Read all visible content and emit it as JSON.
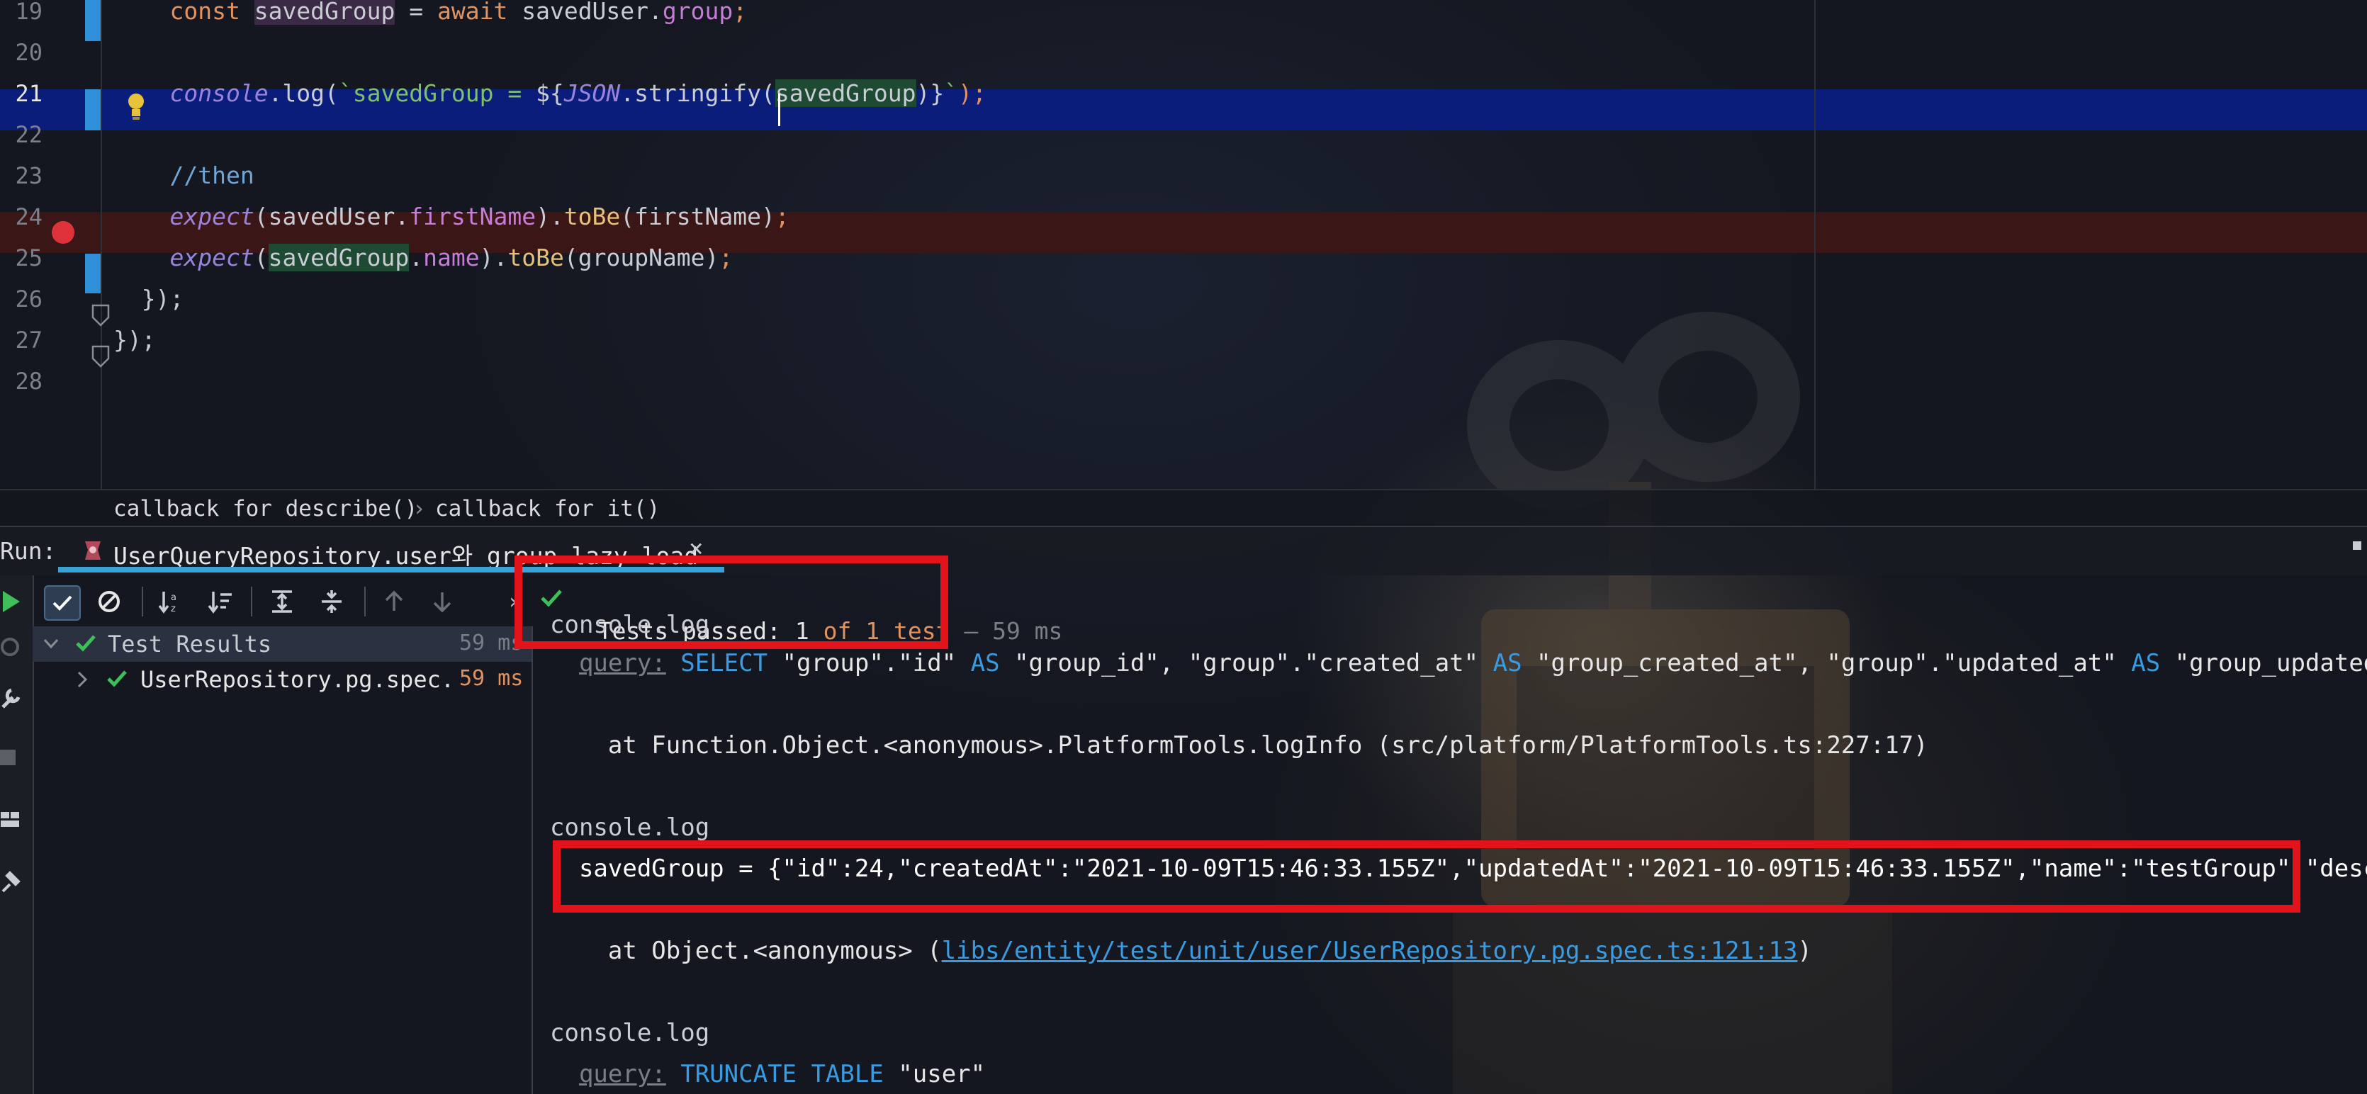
{
  "editor": {
    "lines": [
      {
        "no": "19",
        "segments": [
          {
            "t": "    ",
            "c": "#c9ccd3"
          },
          {
            "t": "const ",
            "c": "#e0935f"
          },
          {
            "t": "savedGroup",
            "c": "#c9ccd3",
            "bg": "#3b2a45"
          },
          {
            "t": " = ",
            "c": "#c9ccd3"
          },
          {
            "t": "await ",
            "c": "#e0935f"
          },
          {
            "t": "savedUser.",
            "c": "#c9ccd3"
          },
          {
            "t": "group",
            "c": "#c77dd8"
          },
          {
            "t": ";",
            "c": "#e0935f"
          }
        ]
      },
      {
        "no": "20",
        "segments": []
      },
      {
        "no": "21",
        "segments": [
          {
            "t": "    ",
            "c": "#c9ccd3"
          },
          {
            "t": "console",
            "c": "#9a84d9",
            "i": true
          },
          {
            "t": ".log(",
            "c": "#c9ccd3"
          },
          {
            "t": "`savedGroup = ",
            "c": "#7fbf6a"
          },
          {
            "t": "${",
            "c": "#c9ccd3"
          },
          {
            "t": "JSON",
            "c": "#9a84d9",
            "i": true
          },
          {
            "t": ".stringify(",
            "c": "#c9ccd3"
          },
          {
            "t": "savedGroup",
            "c": "#c9ccd3",
            "bg": "#1e4a34"
          },
          {
            "t": ")}",
            "c": "#c9ccd3"
          },
          {
            "t": "`",
            "c": "#7fbf6a"
          },
          {
            "t": ");",
            "c": "#e0935f"
          }
        ]
      },
      {
        "no": "22",
        "segments": []
      },
      {
        "no": "23",
        "segments": [
          {
            "t": "    ",
            "c": "#c9ccd3"
          },
          {
            "t": "//then",
            "c": "#6fa6d6"
          }
        ]
      },
      {
        "no": "24",
        "segments": [
          {
            "t": "    ",
            "c": "#c9ccd3"
          },
          {
            "t": "expect",
            "c": "#9a84d9",
            "i": true
          },
          {
            "t": "(savedUser.",
            "c": "#c9ccd3"
          },
          {
            "t": "firstName",
            "c": "#c77dd8"
          },
          {
            "t": ").",
            "c": "#c9ccd3"
          },
          {
            "t": "toBe",
            "c": "#e6c07b"
          },
          {
            "t": "(firstName)",
            "c": "#c9ccd3"
          },
          {
            "t": ";",
            "c": "#e0935f"
          }
        ]
      },
      {
        "no": "25",
        "segments": [
          {
            "t": "    ",
            "c": "#c9ccd3"
          },
          {
            "t": "expect",
            "c": "#9a84d9",
            "i": true
          },
          {
            "t": "(",
            "c": "#c9ccd3"
          },
          {
            "t": "savedGroup",
            "c": "#c9ccd3",
            "bg": "#1e4a34"
          },
          {
            "t": ".",
            "c": "#c9ccd3"
          },
          {
            "t": "name",
            "c": "#c77dd8"
          },
          {
            "t": ").",
            "c": "#c9ccd3"
          },
          {
            "t": "toBe",
            "c": "#e6c07b"
          },
          {
            "t": "(groupName)",
            "c": "#c9ccd3"
          },
          {
            "t": ";",
            "c": "#e0935f"
          }
        ]
      },
      {
        "no": "26",
        "segments": [
          {
            "t": "  });",
            "c": "#c9ccd3"
          }
        ]
      },
      {
        "no": "27",
        "segments": [
          {
            "t": "});",
            "c": "#c9ccd3"
          }
        ]
      },
      {
        "no": "28",
        "segments": []
      }
    ]
  },
  "breadcrumb": {
    "items": [
      "callback for describe()",
      "callback for it()"
    ],
    "separator": "›"
  },
  "run": {
    "label": "Run:",
    "tab_title": "UserQueryRepository.user와 group lazy load",
    "close": "×"
  },
  "status": {
    "prefix": "Tests passed: ",
    "count": "1",
    "of_text": " of 1 test",
    "time": " – 59 ms"
  },
  "tree": {
    "root": {
      "label": "Test Results",
      "time": "59 ms"
    },
    "child": {
      "label": "UserRepository.pg.spec.",
      "time": "59 ms"
    }
  },
  "console": {
    "lines": [
      {
        "segments": [
          {
            "t": "console.log",
            "c": "#c9ccd3"
          }
        ]
      },
      {
        "segments": [
          {
            "t": "  ",
            "c": "#c9ccd3"
          },
          {
            "t": "query:",
            "c": "#7a7e86",
            "u": true
          },
          {
            "t": " SELECT ",
            "c": "#3a9be0"
          },
          {
            "t": "\"group\".\"id\" ",
            "c": "#e6e6e6"
          },
          {
            "t": "AS ",
            "c": "#3a9be0"
          },
          {
            "t": "\"group_id\", \"group\".\"created_at\" ",
            "c": "#e6e6e6"
          },
          {
            "t": "AS ",
            "c": "#3a9be0"
          },
          {
            "t": "\"group_created_at\", \"group\".\"updated_at\" ",
            "c": "#e6e6e6"
          },
          {
            "t": "AS ",
            "c": "#3a9be0"
          },
          {
            "t": "\"group_updated_at\"",
            "c": "#e6e6e6"
          }
        ]
      },
      {
        "segments": []
      },
      {
        "segments": [
          {
            "t": "    at Function.Object.<anonymous>.PlatformTools.logInfo (src/platform/PlatformTools.ts:227:17)",
            "c": "#e6e6e6"
          }
        ]
      },
      {
        "segments": []
      },
      {
        "segments": [
          {
            "t": "console.log",
            "c": "#c9ccd3"
          }
        ]
      },
      {
        "segments": [
          {
            "t": "  savedGroup = {\"id\":24,\"createdAt\":\"2021-10-09T15:46:33.155Z\",\"updatedAt\":\"2021-10-09T15:46:33.155Z\",\"name\":\"testGroup\",\"descrip",
            "c": "#ffffff"
          }
        ]
      },
      {
        "segments": []
      },
      {
        "segments": [
          {
            "t": "    at Object.<anonymous> (",
            "c": "#e6e6e6"
          },
          {
            "t": "libs/entity/test/unit/user/UserRepository.pg.spec.ts:121:13",
            "c": "#3a9be0",
            "u": true
          },
          {
            "t": ")",
            "c": "#e6e6e6"
          }
        ]
      },
      {
        "segments": []
      },
      {
        "segments": [
          {
            "t": "console.log",
            "c": "#c9ccd3"
          }
        ]
      },
      {
        "segments": [
          {
            "t": "  ",
            "c": "#c9ccd3"
          },
          {
            "t": "query:",
            "c": "#7a7e86",
            "u": true
          },
          {
            "t": " TRUNCATE TABLE ",
            "c": "#3a9be0"
          },
          {
            "t": "\"user\"",
            "c": "#e6e6e6"
          }
        ]
      }
    ]
  },
  "toolbar": {
    "icons": [
      "run-icon",
      "check-filter-icon",
      "stop-filter-icon",
      "sort-alpha-icon",
      "sort-duration-icon",
      "expand-all-icon",
      "collapse-all-icon",
      "prev-failed-icon",
      "next-failed-icon",
      "more-icon"
    ]
  },
  "colors": {
    "accent": "#3aa2d6",
    "pass": "#3fbf5a",
    "highlight_line": "#0b1d7a",
    "breakpoint_line": "#3a1616",
    "breakpoint": "#e0323a",
    "redbox": "#e3131c"
  }
}
